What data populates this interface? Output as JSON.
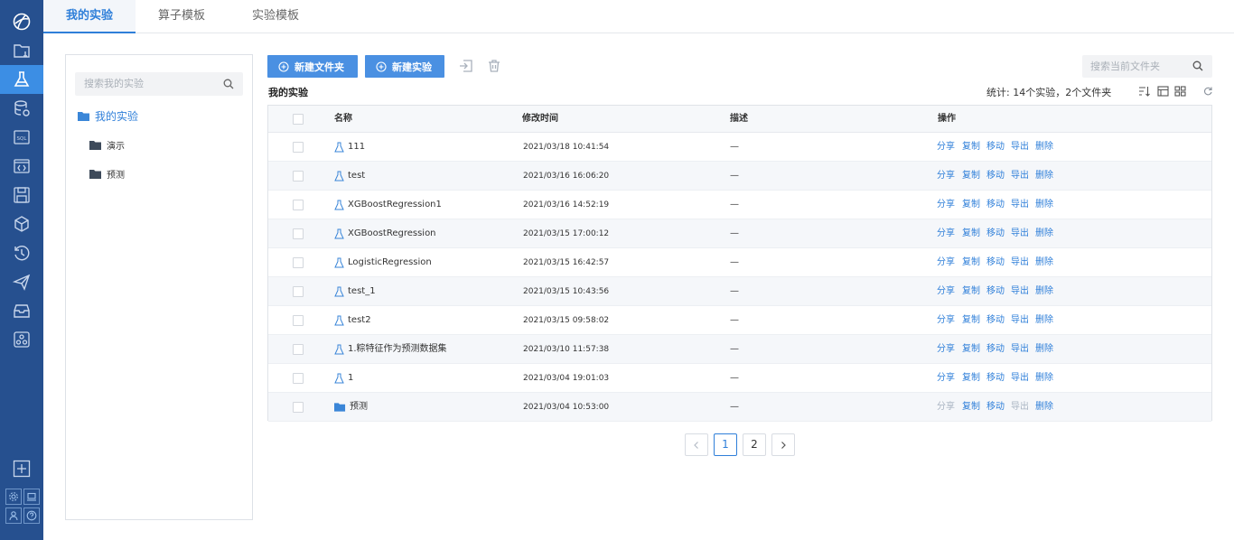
{
  "tabs": [
    {
      "label": "我的实验"
    },
    {
      "label": "算子模板"
    },
    {
      "label": "实验模板"
    }
  ],
  "rail": {
    "items": [
      "logo-icon",
      "folder-icon",
      "experiment-flask-icon",
      "database-icon",
      "sql-icon",
      "code-icon",
      "save-icon",
      "cube-icon",
      "history-icon",
      "send-icon",
      "archive-icon",
      "cluster-icon"
    ],
    "bottom": [
      "add-icon",
      "settings-icon",
      "monitor-icon",
      "user-icon",
      "help-icon"
    ]
  },
  "tree": {
    "search_placeholder": "搜索我的实验",
    "root": "我的实验",
    "children": [
      "演示",
      "预测"
    ]
  },
  "toolbar": {
    "new_folder": "新建文件夹",
    "new_experiment": "新建实验",
    "search_placeholder": "搜索当前文件夹"
  },
  "section_title": "我的实验",
  "stats": "统计: 14个实验，2个文件夹",
  "table": {
    "headers": {
      "name": "名称",
      "modified": "修改时间",
      "desc": "描述",
      "ops": "操作"
    },
    "rows": [
      {
        "type": "experiment",
        "name": "111",
        "modified": "2021/03/18 10:41:54",
        "desc": "—"
      },
      {
        "type": "experiment",
        "name": "test",
        "modified": "2021/03/16 16:06:20",
        "desc": "—"
      },
      {
        "type": "experiment",
        "name": "XGBoostRegression1",
        "modified": "2021/03/16 14:52:19",
        "desc": "—"
      },
      {
        "type": "experiment",
        "name": "XGBoostRegression",
        "modified": "2021/03/15 17:00:12",
        "desc": "—"
      },
      {
        "type": "experiment",
        "name": "LogisticRegression",
        "modified": "2021/03/15 16:42:57",
        "desc": "—"
      },
      {
        "type": "experiment",
        "name": "test_1",
        "modified": "2021/03/15 10:43:56",
        "desc": "—"
      },
      {
        "type": "experiment",
        "name": "test2",
        "modified": "2021/03/15 09:58:02",
        "desc": "—"
      },
      {
        "type": "experiment",
        "name": "1.粽特征作为预测数据集",
        "modified": "2021/03/10 11:57:38",
        "desc": "—"
      },
      {
        "type": "experiment",
        "name": "1",
        "modified": "2021/03/04 19:01:03",
        "desc": "—"
      },
      {
        "type": "folder",
        "name": "预测",
        "modified": "2021/03/04 10:53:00",
        "desc": "—"
      }
    ],
    "actions": [
      "分享",
      "复制",
      "移动",
      "导出",
      "删除"
    ]
  },
  "pagination": {
    "pages": [
      "1",
      "2"
    ],
    "current": "1"
  },
  "colors": {
    "rail": "#26508f",
    "rail_active": "#3c8ee4",
    "primary": "#4a90e2",
    "link": "#2f7fd9",
    "disabled": "#a9b4c2"
  }
}
